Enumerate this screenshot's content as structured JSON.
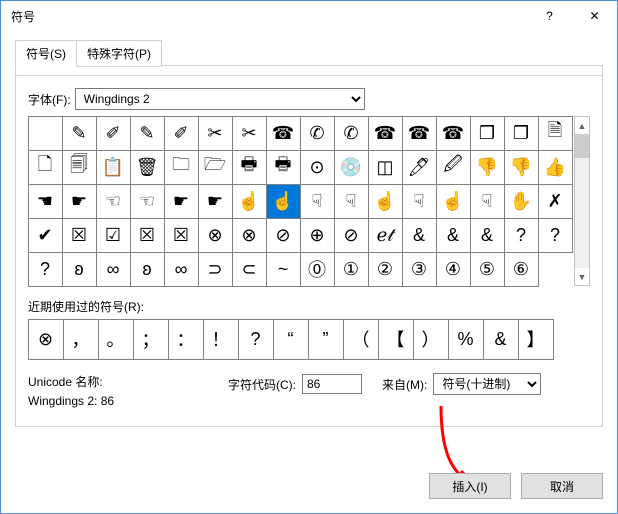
{
  "dialog": {
    "title": "符号"
  },
  "tabs": {
    "symbol": "符号(S)",
    "special": "特殊字符(P)"
  },
  "font_row": {
    "label": "字体(F):",
    "font": "Wingdings 2"
  },
  "symbol_grid": {
    "selected_index": 39,
    "rows": [
      [
        "",
        "✎",
        "✐",
        "✎",
        "✐",
        "✂",
        "✂",
        "☎",
        "✆",
        "✆",
        "☎",
        "☎",
        "☎",
        "❐",
        "❐",
        "🗎"
      ],
      [
        "🗋",
        "🗐",
        "📋",
        "🗑",
        "🗀",
        "🗁",
        "🖶",
        "🖶",
        "⊙",
        "💿",
        "◫",
        "🖊",
        "🖉",
        "👎",
        "👎",
        "👍"
      ],
      [
        "☚",
        "☛",
        "☜",
        "☜",
        "☛",
        "☛",
        "☝",
        "☝",
        "☟",
        "☟",
        "☝",
        "☟",
        "☝",
        "☟",
        "✋",
        "✗"
      ],
      [
        "✔",
        "☒",
        "☑",
        "☒",
        "☒",
        "⊗",
        "⊗",
        "⊘",
        "⊕",
        "⊘",
        "ℯ𝓉",
        "&",
        "&",
        "&",
        "?",
        "?"
      ],
      [
        "?",
        "ʚ",
        "∞",
        "ʚ",
        "∞",
        "⊃",
        "⊂",
        "~",
        "⓪",
        "①",
        "②",
        "③",
        "④",
        "⑤",
        "⑥"
      ]
    ]
  },
  "recent": {
    "label": "近期使用过的符号(R):",
    "items": [
      "⊗",
      "，",
      "。",
      "；",
      "：",
      "！",
      "?",
      "“",
      "”",
      "（",
      "【",
      "）",
      "%",
      "&",
      "】"
    ]
  },
  "info": {
    "unicode_name_label": "Unicode 名称:",
    "unicode_name_value": "Wingdings 2: 86",
    "code_label": "字符代码(C):",
    "code_value": "86",
    "from_label": "来自(M):",
    "from_value": "符号(十进制)"
  },
  "buttons": {
    "insert": "插入(I)",
    "cancel": "取消"
  }
}
